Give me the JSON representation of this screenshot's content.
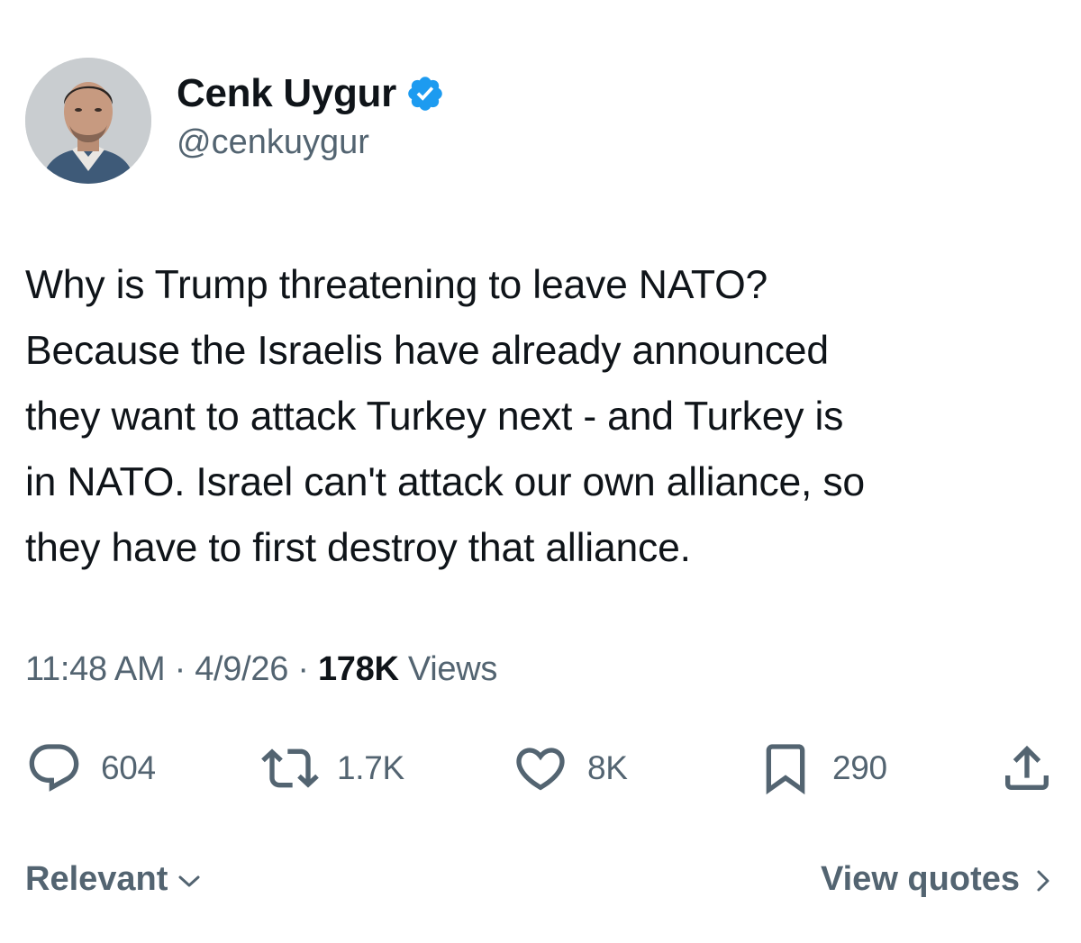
{
  "author": {
    "display_name": "Cenk Uygur",
    "handle": "@cenkuygur",
    "verified_icon": "verified-badge-icon",
    "badge_color": "#1d9bf0"
  },
  "tweet": {
    "lines": [
      "Why is Trump threatening to leave NATO?",
      "Because the Israelis have already announced",
      "they want to attack Turkey next - and Turkey is",
      "in NATO. Israel can't attack our own alliance, so",
      "they have to first destroy that alliance."
    ]
  },
  "meta": {
    "time": "11:48 AM",
    "sep1": " · ",
    "date": "4/9/26",
    "sep2": " · ",
    "views_count": "178K",
    "views_label": " Views"
  },
  "actions": {
    "replies": {
      "icon": "reply-icon",
      "count": "604"
    },
    "reposts": {
      "icon": "repost-icon",
      "count": "1.7K"
    },
    "likes": {
      "icon": "like-icon",
      "count": "8K"
    },
    "bookmarks": {
      "icon": "bookmark-icon",
      "count": "290"
    },
    "share": {
      "icon": "share-icon"
    }
  },
  "footer": {
    "sort_label": "Relevant",
    "view_quotes_label": "View quotes"
  },
  "colors": {
    "text_primary": "#0f1419",
    "text_secondary": "#536471",
    "accent": "#1d9bf0"
  }
}
